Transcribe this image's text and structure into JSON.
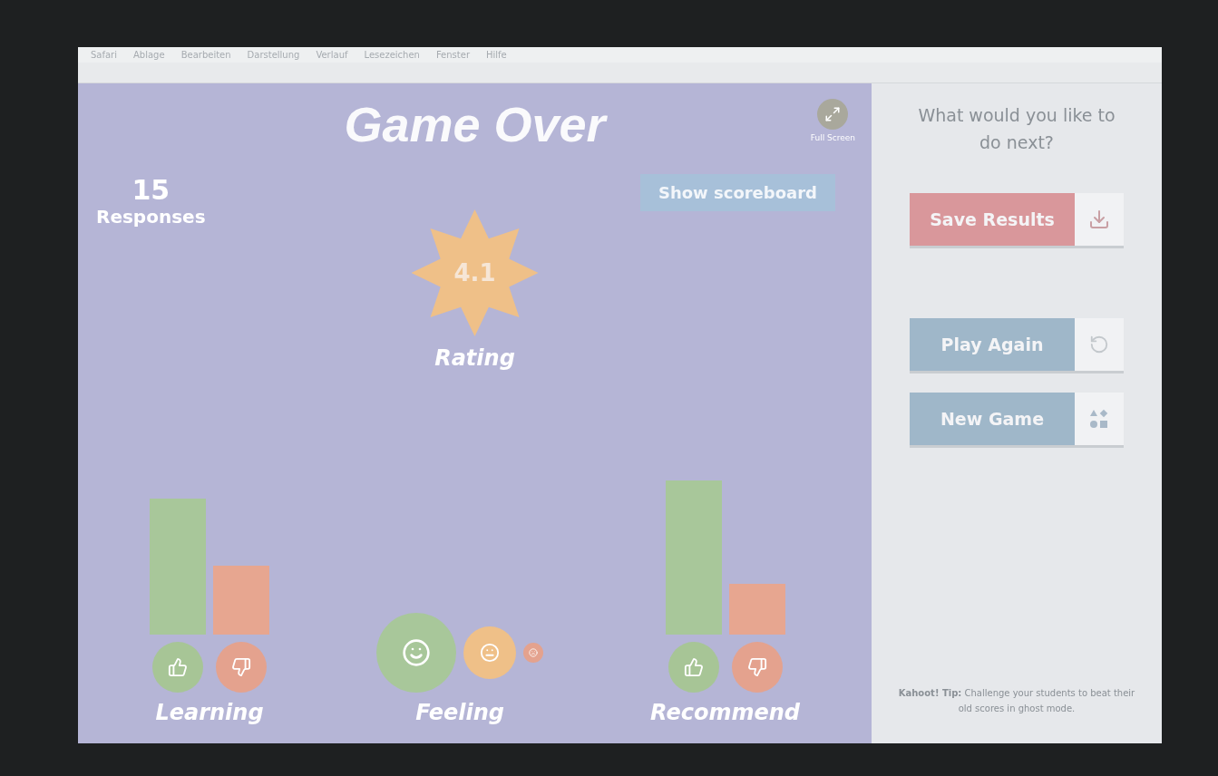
{
  "menu_bar": {
    "items": [
      "Safari",
      "Ablage",
      "Bearbeiten",
      "Darstellung",
      "Verlauf",
      "Lesezeichen",
      "Fenster",
      "Hilfe"
    ]
  },
  "game": {
    "title": "Game Over",
    "full_screen_label": "Full Screen",
    "responses": {
      "count": "15",
      "label": "Responses"
    },
    "scoreboard_button": "Show scoreboard",
    "rating": {
      "value": "4.1",
      "label": "Rating"
    },
    "metrics": [
      {
        "kind": "thumbs",
        "label": "Learning"
      },
      {
        "kind": "faces",
        "label": "Feeling"
      },
      {
        "kind": "thumbs",
        "label": "Recommend"
      }
    ]
  },
  "sidebar": {
    "prompt": "What would you like to do next?",
    "buttons": [
      {
        "kind": "save",
        "label": "Save Results",
        "color": "#d9979b"
      },
      {
        "kind": "replay",
        "label": "Play Again",
        "color": "#9fb7c9"
      },
      {
        "kind": "new",
        "label": "New Game",
        "color": "#9fb7c9"
      }
    ],
    "tip": "**Kahoot! Tip:** Challenge your students to beat their old scores in ghost mode."
  }
}
